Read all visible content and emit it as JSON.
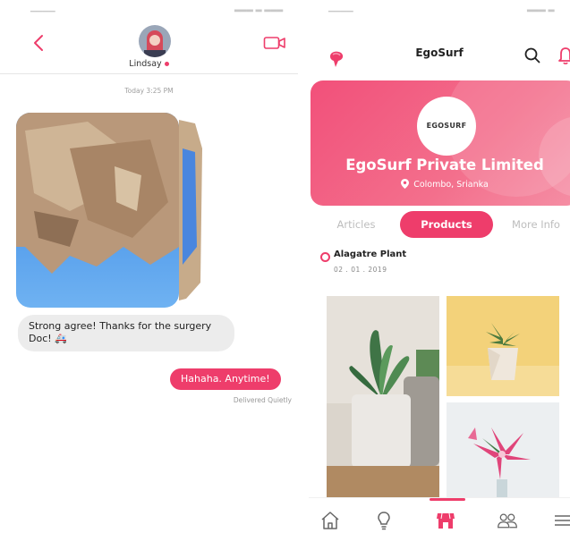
{
  "colors": {
    "accent": "#ee3d6b",
    "bubble_incoming": "#ececec",
    "text_dark": "#222222"
  },
  "chat": {
    "contact_name": "Lindsay",
    "timestamp": "Today 3:25 PM",
    "messages": [
      {
        "direction": "incoming",
        "text": "Strong agree! Thanks for the surgery Doc! 🚑"
      },
      {
        "direction": "outgoing",
        "text": "Hahaha. Anytime!"
      }
    ],
    "delivery_status": "Delivered Quietly",
    "icons": {
      "back": "chevron-left-icon",
      "video": "video-camera-icon"
    }
  },
  "profile": {
    "app_title": "EgoSurf",
    "company": {
      "logo_text": "EGOSURF",
      "name": "EgoSurf Private Limited",
      "location": "Colombo, Srianka"
    },
    "tabs": [
      {
        "label": "Articles",
        "active": false
      },
      {
        "label": "Products",
        "active": true
      },
      {
        "label": "More Info",
        "active": false
      }
    ],
    "post": {
      "title": "Alagatre Plant",
      "date": "02 . 01 . 2019"
    },
    "bottom_nav": [
      {
        "icon": "home-icon",
        "active": false
      },
      {
        "icon": "lightbulb-icon",
        "active": false
      },
      {
        "icon": "store-icon",
        "active": true
      },
      {
        "icon": "users-icon",
        "active": false
      },
      {
        "icon": "menu-icon",
        "active": false
      }
    ]
  }
}
